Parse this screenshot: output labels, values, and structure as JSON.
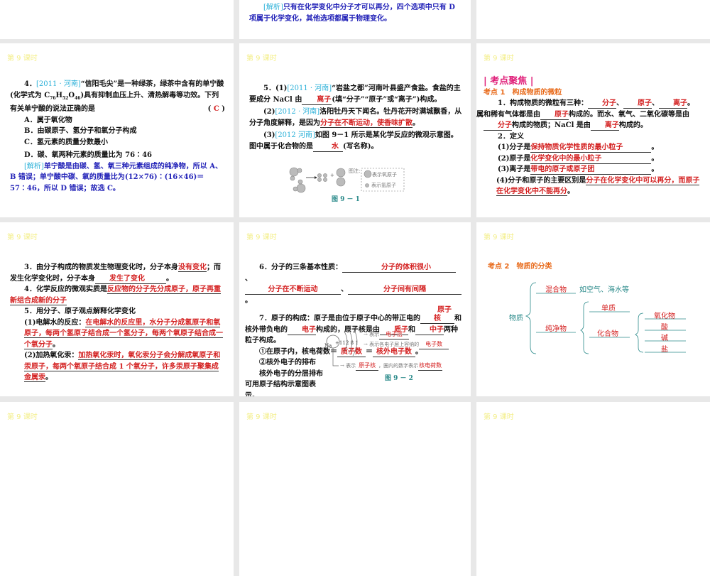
{
  "lesson_label": "第 9 课时",
  "s0": {
    "analysis_tag": "[解析]",
    "analysis": "只有在化学变化中分子才可以再分，四个选项中只有 D 项属于化学变化，其他选项都属于物理变化。"
  },
  "s1": {
    "num": "4．",
    "src": "[2011 · 河南]",
    "stem1": "“信阳毛尖”是一种绿茶，绿茶中含有的单宁酸(化学式为 C",
    "sub1": "76",
    "h": "H",
    "sub2": "52",
    "o": "O",
    "sub3": "46",
    "stem2": ")具有抑制血压上升、清热解毒等功效。下列有关单宁酸的说法正确的是",
    "paren_l": "(",
    "answer": "C",
    "paren_r": ")",
    "options": [
      "A．属于氧化物",
      "B．由碳原子、氢分子和氧分子构成",
      "C．氢元素的质量分数最小",
      "D．碳、氧两种元素的质量比为 76∶46"
    ],
    "analysis_tag": "[解析]",
    "analysis": "单宁酸是由碳、氢、氧三种元素组成的纯净物，所以 A、B 错误；单宁酸中碳、氧的质量比为(12×76)∶(16×46)＝57∶46，所以 D 错误；故选 C。"
  },
  "s2": {
    "p1a": "5．(1)",
    "src1": "[2011 · 河南]",
    "p1b": "“岩盐之都”河南叶县盛产食盐。食盐的主要成分 NaCl 由",
    "a1": "离子",
    "p1c": "(填“分子”“原子”或“离子”)构成。",
    "p2a": "(2)",
    "src2": "[2012 · 河南]",
    "p2b": "洛阳牡丹天下闻名。牡丹花开时满城飘香，从分子角度解释，是因为",
    "a2": "分子在不断运动，使香味扩散",
    "p2c": "。",
    "p3a": "(3)",
    "src3": "[2012 河南]",
    "p3b": "如图 9－1 所示是某化学反应的微观示意图。图中属于化合物的是",
    "a3": "水",
    "p3c": "(写名称)。",
    "legend_title": "图注:",
    "legend_o": "表示氧原子",
    "legend_h": "表示氢原子",
    "plus": "+",
    "fig": "图 9 － 1"
  },
  "s3": {
    "title": "| 考点聚焦 |",
    "kd": "考点 1　构成物质的微粒",
    "l1a": "1．构成物质的微粒有三种：",
    "b1": "分子",
    "sep": "、",
    "b2": "原子",
    "b3": "离子",
    "dot": "。",
    "l2a": "金属和稀有气体都是由",
    "b4": "原子",
    "l2b": "构成的。而水、氧气、二氧化碳等是由",
    "b5": "分子",
    "l2c": "构成的物质；NaCl 是由",
    "b6": "离子",
    "l2d": "构成的。",
    "def": "2．定义",
    "d1": "(1)分子是",
    "a1": "保持物质化学性质的最小粒子",
    "d2": "(2)原子是",
    "a2": "化学变化中的最小粒子",
    "d3": "(3)离子是",
    "a3": "带电的原子或原子团",
    "d4": "(4)分子和原子的主要区别是",
    "a4": "分子在化学变化中可以再分，而原子在化学变化中不能再分"
  },
  "s4": {
    "l3a": "3．由分子构成的物质发生物理变化时，分子本身",
    "a3a": "没有变化",
    "l3b": "；而发生化学变化时，分子本身",
    "a3b": "发生了变化",
    "dot": "。",
    "l4": "4．化学反应的微观实质是",
    "a4": "反应物的分子先分成原子，原子再重新组合成新的分子",
    "l5": "5．用分子、原子观点解释化学变化",
    "q1": "(1)电解水的反应：",
    "a5": "在电解水的反应里，水分子分成氢原子和氧原子，每两个氢原子结合成一个氢分子，每两个氧原子结合成一个氧分子",
    "q2": "(2)加热氧化汞：",
    "a6": "加热氧化汞时，氧化汞分子会分解成氧原子和汞原子，每两个氧原子结合成 1 个氧分子，许多汞原子聚集成金属汞"
  },
  "s5": {
    "l6": "6．分子的三条基本性质：",
    "a6a": "分子的体积很小",
    "a6b": "分子在不断运动",
    "a6c": "分子间有间隔",
    "sep": "、",
    "dot": "。",
    "l7a": "7．原子的构成：原子是由位于原子中心的带正电的",
    "a7a": "原子核",
    "l7b": "和核外带负电的",
    "a7b": "电子",
    "l7c": "构成的，原子核是由",
    "a7c": "质子",
    "he": "和",
    "a7d": "中子",
    "l7d": "两种粒子构成。",
    "c1a": "①在原子内，核电荷数＝",
    "c1b": "质子数",
    "eq": "＝",
    "c1c": "核外电子数",
    "c2": "②核外电子的排布",
    "c2b": "核外电子的分层排布可用原子结构示意图表示。",
    "na": "Na",
    "nuc": "+11",
    "shells": "2 8 1",
    "r1": "表示",
    "r1a": "电子层",
    "r2": "表示各电子层上容纳的",
    "r2a": "电子数",
    "r3": "表示",
    "r3a": "原子核",
    "r3b": "，圈内的数字表示",
    "r3c": "核电荷数",
    "fig": "图 9 － 2"
  },
  "s6": {
    "kd": "考点 2　物质的分类",
    "root": "物质",
    "mix": "混合物",
    "mix_eg": "如空气、海水等",
    "pure": "纯净物",
    "elem": "单质",
    "comp": "化合物",
    "leaves": [
      "氧化物",
      "酸",
      "碱",
      "盐"
    ]
  }
}
